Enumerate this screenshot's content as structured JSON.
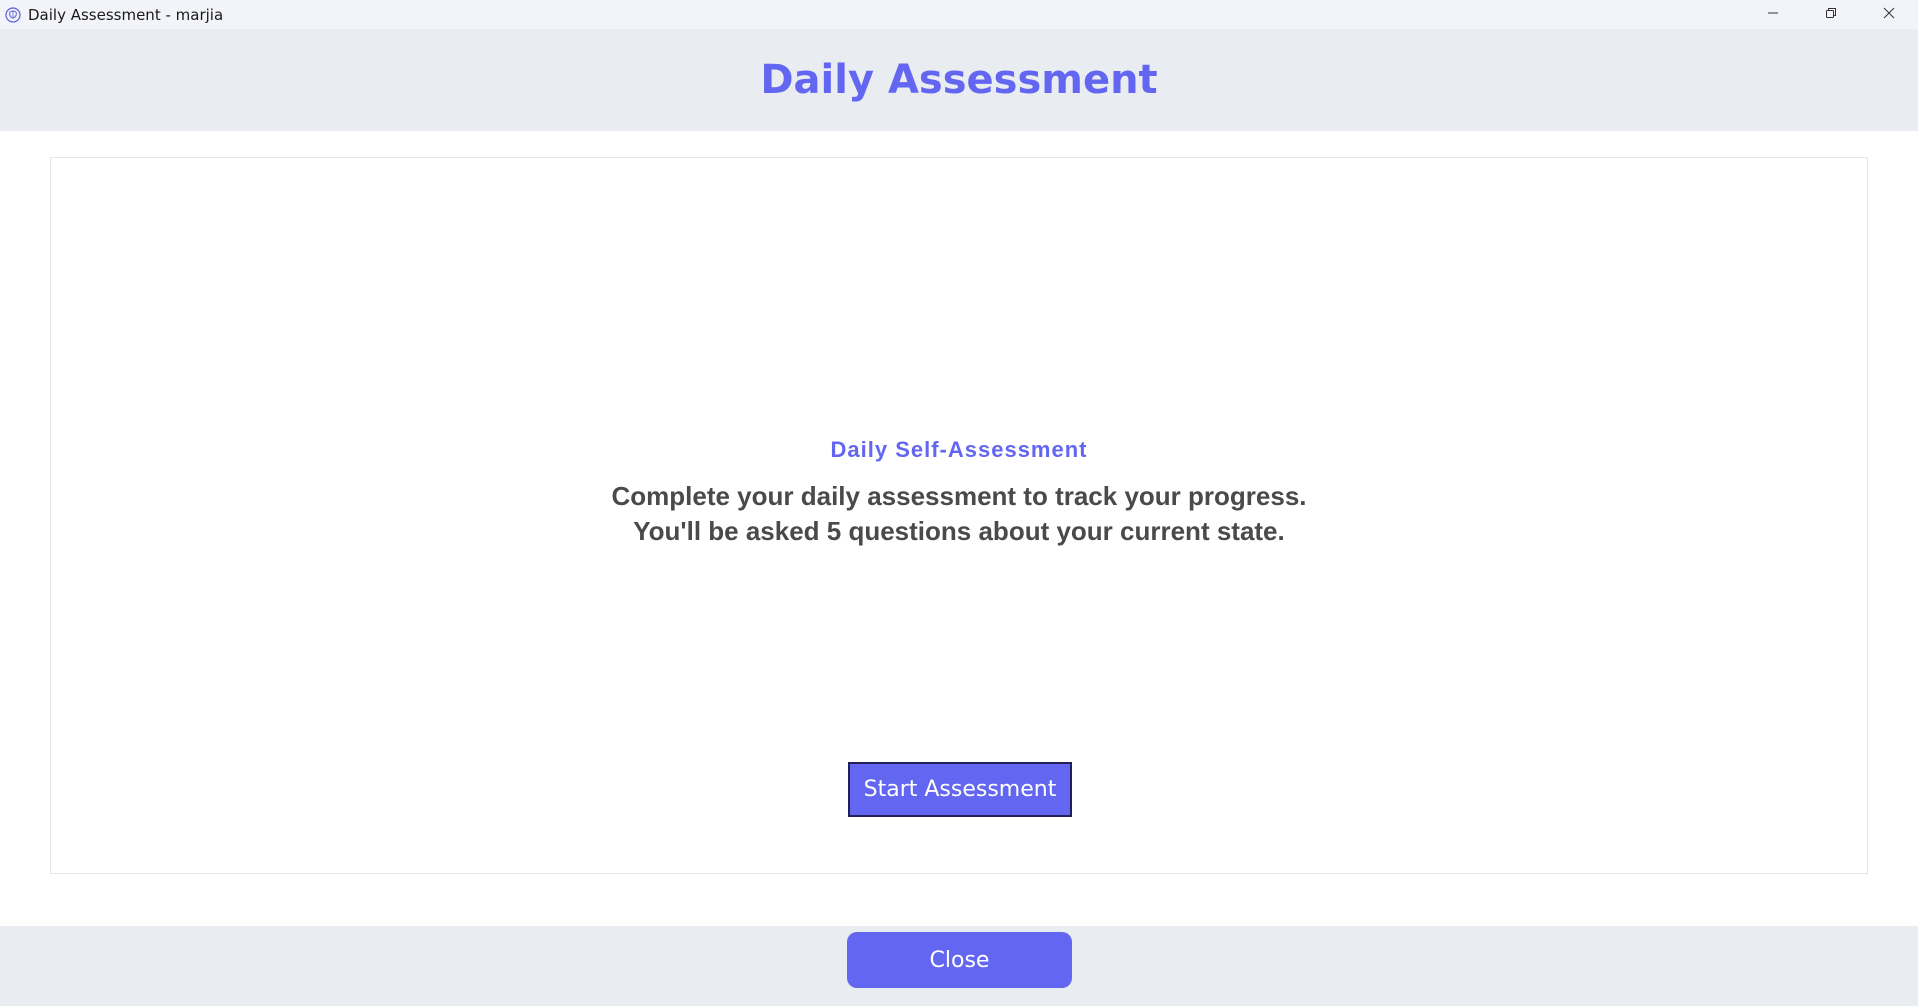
{
  "window": {
    "title": "Daily Assessment - marjia",
    "app_icon": "brain-icon",
    "controls": {
      "minimize_icon": "minimize-icon",
      "restore_icon": "restore-icon",
      "close_icon": "close-icon"
    }
  },
  "header": {
    "title": "Daily Assessment"
  },
  "card": {
    "subtitle": "Daily Self-Assessment",
    "description_line1": "Complete your daily assessment to track your progress.",
    "description_line2": "You'll be asked 5 questions about your current state.",
    "start_button_label": "Start Assessment"
  },
  "footer": {
    "close_button_label": "Close"
  },
  "colors": {
    "accent": "#6366f1",
    "header_bg": "#e9ecf1",
    "text_dark": "#4a4a4a"
  }
}
